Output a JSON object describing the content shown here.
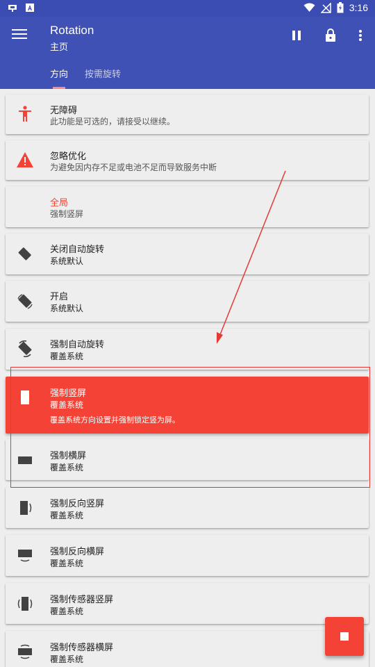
{
  "statusbar": {
    "time": "3:16",
    "left_icons": [
      "app-notification-icon",
      "app-notification-icon"
    ],
    "right_icons": [
      "wifi-icon",
      "signal-icon",
      "battery-icon"
    ]
  },
  "appbar": {
    "title": "Rotation",
    "subtitle": "主页",
    "actions": [
      "pause-icon",
      "lock-icon",
      "more-vert-icon"
    ],
    "tabs": [
      {
        "label": "方向",
        "active": true
      },
      {
        "label": "按需旋转",
        "active": false
      }
    ],
    "color": "#3f51b5"
  },
  "cards": [
    {
      "title": "无障碍",
      "subtitle": "此功能是可选的，请接受以继续。",
      "icon": "accessibility-icon"
    },
    {
      "title": "忽略优化",
      "subtitle": "为避免因内存不足或电池不足而导致服务中断",
      "icon": "warning-icon"
    },
    {
      "title": "全局",
      "subtitle": "强制竖屏",
      "icon": ""
    },
    {
      "title": "关闭自动旋转",
      "subtitle": "系统默认",
      "icon": "rotation-lock-icon"
    },
    {
      "title": "开启",
      "subtitle": "系统默认",
      "icon": "auto-rotate-icon"
    },
    {
      "title": "强制自动旋转",
      "subtitle": "覆盖系统",
      "icon": "force-auto-rotate-icon"
    },
    {
      "title": "强制竖屏",
      "subtitle": "覆盖系统",
      "description": "覆盖系统方向设置并强制锁定竖为屏。",
      "icon": "portrait-icon",
      "selected": true
    },
    {
      "title": "强制横屏",
      "subtitle": "覆盖系统",
      "icon": "landscape-icon"
    },
    {
      "title": "强制反向竖屏",
      "subtitle": "覆盖系统",
      "icon": "reverse-portrait-icon"
    },
    {
      "title": "强制反向横屏",
      "subtitle": "覆盖系统",
      "icon": "reverse-landscape-icon"
    },
    {
      "title": "强制传感器竖屏",
      "subtitle": "覆盖系统",
      "icon": "sensor-portrait-icon"
    },
    {
      "title": "强制传感器横屏",
      "subtitle": "覆盖系统",
      "icon": "sensor-landscape-icon"
    }
  ],
  "fab": {
    "icon": "stop-icon"
  },
  "colors": {
    "accent": "#f44336",
    "primary": "#3f51b5",
    "annotation": "#e53935"
  }
}
